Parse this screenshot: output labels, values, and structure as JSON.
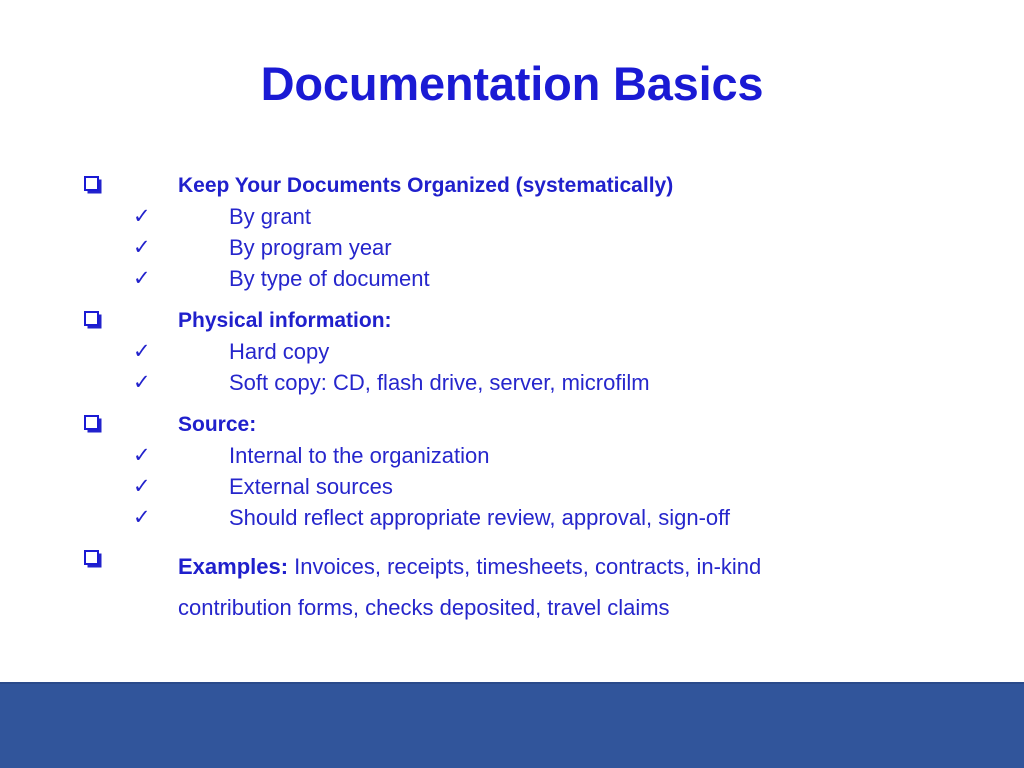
{
  "slide": {
    "title": "Documentation Basics",
    "title_color": "#1a1ad4",
    "body_color": "#2626cc",
    "heading_color": "#2020cc",
    "background_color": "#ffffff",
    "band_color": "#31559b",
    "bullet_square_glyph": "square-bullet",
    "bullet_check_glyph": "✓"
  },
  "groups": [
    {
      "heading": "Keep Your Documents Organized (systematically)",
      "items": [
        "By grant",
        "By program year",
        "By type of document"
      ]
    },
    {
      "heading": "Physical information:",
      "items": [
        "Hard copy",
        "Soft copy: CD, flash drive, server, microfilm"
      ]
    },
    {
      "heading": "Source:",
      "items": [
        "Internal to the organization",
        "External sources",
        "Should reflect appropriate review, approval, sign-off"
      ]
    }
  ],
  "examples": {
    "label": "Examples:",
    "text": " Invoices, receipts, timesheets, contracts, in-kind contribution forms, checks deposited, travel claims"
  }
}
